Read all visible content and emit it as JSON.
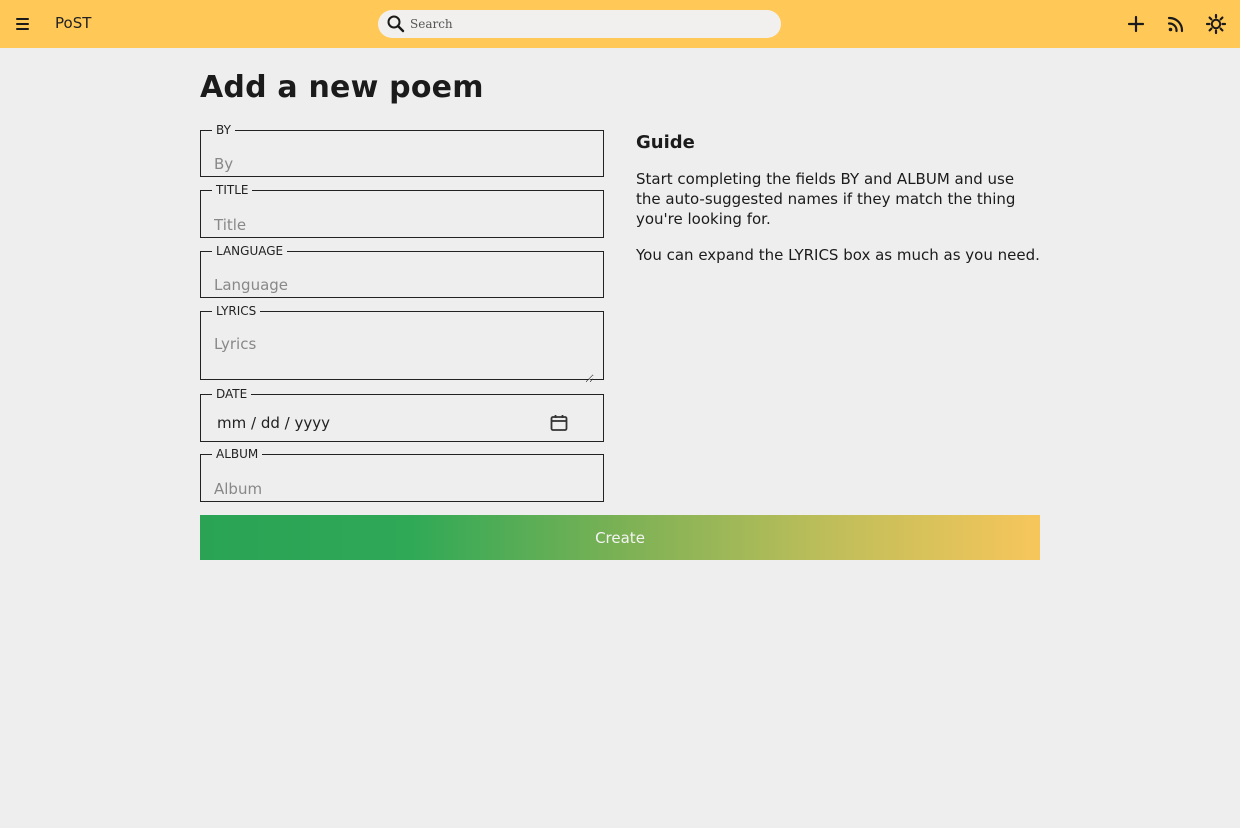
{
  "app": {
    "brand": "PoST"
  },
  "search": {
    "placeholder": "Search"
  },
  "icons": {
    "menu": "hamburger-icon",
    "search": "search-icon",
    "add": "plus-icon",
    "feed": "rss-icon",
    "theme": "sun-icon",
    "calendar": "calendar-icon"
  },
  "colors": {
    "topbar": "#ffc857",
    "page_bg": "#eeeeee",
    "button_gradient_start": "#2aa355",
    "button_gradient_end": "#f7c65b"
  },
  "page": {
    "title": "Add a new poem"
  },
  "form": {
    "by": {
      "label": "BY",
      "placeholder": "By",
      "value": ""
    },
    "title": {
      "label": "TITLE",
      "placeholder": "Title",
      "value": ""
    },
    "language": {
      "label": "LANGUAGE",
      "placeholder": "Language",
      "value": ""
    },
    "lyrics": {
      "label": "LYRICS",
      "placeholder": "Lyrics",
      "value": ""
    },
    "date": {
      "label": "DATE",
      "display": "mm / dd / yyyy",
      "value": ""
    },
    "album": {
      "label": "ALBUM",
      "placeholder": "Album",
      "value": ""
    },
    "submit_label": "Create"
  },
  "guide": {
    "heading": "Guide",
    "paragraphs": [
      "Start completing the fields BY and ALBUM and use the auto-suggested names if they match the thing you're looking for.",
      "You can expand the LYRICS box as much as you need."
    ]
  }
}
